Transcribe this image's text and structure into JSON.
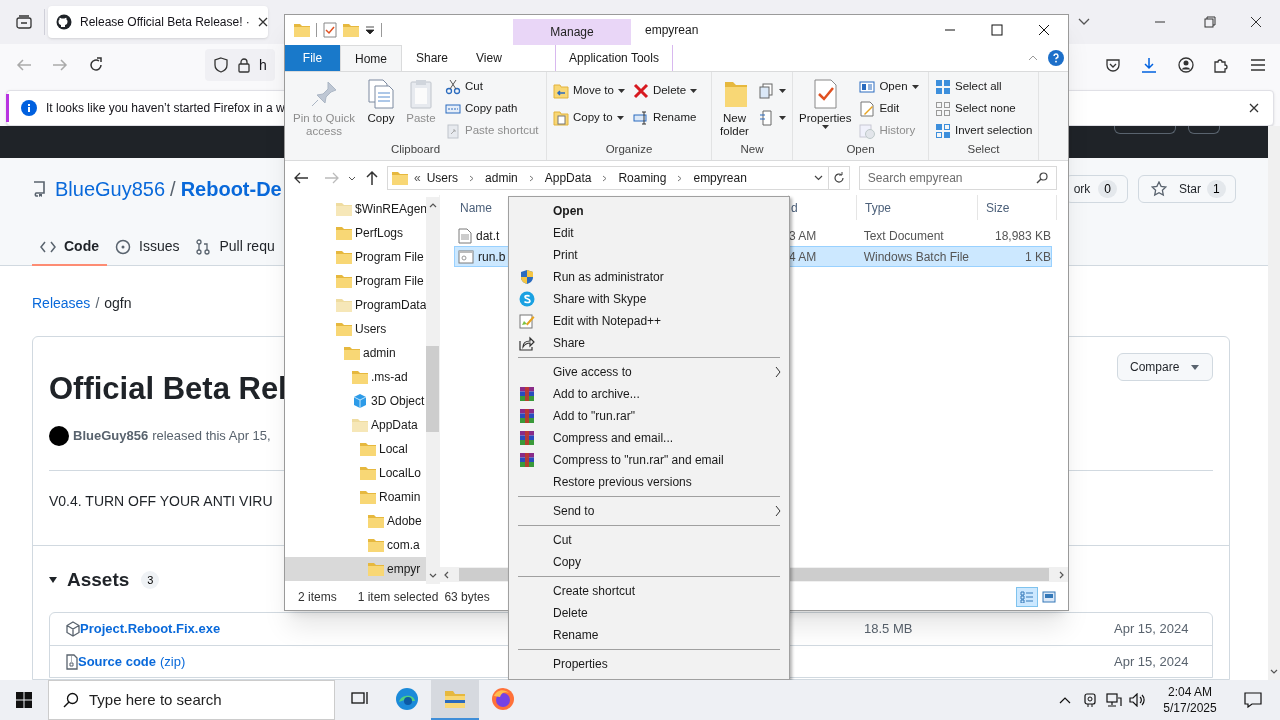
{
  "browser": {
    "tab": {
      "title": "Release Official Beta Release! ·"
    },
    "address": {
      "value": "h"
    },
    "notification": {
      "text": "It looks like you haven’t started Firefox in a w"
    }
  },
  "github": {
    "owner": "BlueGuy856",
    "separator": "/",
    "repo": "Reboot-De",
    "tabs": [
      {
        "label": "Code",
        "selected": true
      },
      {
        "label": "Issues",
        "selected": false
      },
      {
        "label": "Pull requ",
        "selected": false
      }
    ],
    "fork": {
      "label": "ork",
      "count": "0"
    },
    "star": {
      "label": "Star",
      "count": "1"
    },
    "breadcrumb": {
      "link": "Releases",
      "separator": "/",
      "current": "ogfn"
    },
    "release": {
      "title": "Official Beta Rel",
      "author": "BlueGuy856",
      "meta": "released this Apr 15,",
      "body": "V0.4. TURN OFF YOUR ANTI VIRU",
      "compare": "Compare"
    },
    "assets": {
      "label": "Assets",
      "count": "3",
      "items": [
        {
          "kind": "package",
          "name": "Project.Reboot.Fix.exe",
          "size": "18.5 MB",
          "date": "Apr 15, 2024"
        },
        {
          "kind": "zip",
          "name": "Source code",
          "suffix": "(zip)",
          "date": "Apr 15, 2024"
        }
      ]
    }
  },
  "explorer": {
    "title": "empyrean",
    "context_tab": "Manage",
    "tabs": [
      {
        "label": "File",
        "selected": false,
        "kind": "file"
      },
      {
        "label": "Home",
        "selected": true,
        "kind": "normal"
      },
      {
        "label": "Share",
        "selected": false,
        "kind": "normal"
      },
      {
        "label": "View",
        "selected": false,
        "kind": "normal"
      },
      {
        "label": "Application Tools",
        "selected": false,
        "kind": "context"
      }
    ],
    "groups": [
      {
        "label": "Clipboard",
        "large": [
          {
            "label": "Pin to Quick access",
            "kind": "pin",
            "disabled": true,
            "dropdown": false
          },
          {
            "label": "Copy",
            "kind": "copy",
            "disabled": false,
            "dropdown": false
          },
          {
            "label": "Paste",
            "kind": "paste",
            "disabled": true,
            "dropdown": false
          }
        ],
        "small": [
          [
            {
              "label": "Cut",
              "kind": "cut",
              "disabled": false,
              "dropdown": false
            },
            {
              "label": "Copy path",
              "kind": "copy-path",
              "disabled": false,
              "dropdown": false
            },
            {
              "label": "Paste shortcut",
              "kind": "paste-shortcut",
              "disabled": true,
              "dropdown": false
            }
          ]
        ]
      },
      {
        "label": "Organize",
        "small": [
          [
            {
              "label": "Move to",
              "kind": "move",
              "disabled": false,
              "dropdown": true
            },
            {
              "label": "Copy to",
              "kind": "copy-to",
              "disabled": false,
              "dropdown": true
            }
          ],
          [
            {
              "label": "Delete",
              "kind": "delete",
              "disabled": false,
              "dropdown": true
            },
            {
              "label": "Rename",
              "kind": "rename",
              "disabled": false,
              "dropdown": false
            }
          ]
        ]
      },
      {
        "label": "New",
        "large": [
          {
            "label": "New folder",
            "kind": "new-folder",
            "disabled": false,
            "dropdown": false
          }
        ],
        "small": [
          [
            {
              "kind": "new-item",
              "disabled": false,
              "dropdown": true
            },
            {
              "kind": "easy-access",
              "disabled": false,
              "dropdown": true
            }
          ]
        ]
      },
      {
        "label": "Open",
        "large": [
          {
            "label": "Properties",
            "kind": "properties",
            "disabled": false,
            "dropdown": true
          }
        ],
        "small": [
          [
            {
              "label": "Open",
              "kind": "open",
              "disabled": false,
              "dropdown": true
            },
            {
              "label": "Edit",
              "kind": "edit",
              "disabled": false,
              "dropdown": false
            },
            {
              "label": "History",
              "kind": "history",
              "disabled": true,
              "dropdown": false
            }
          ]
        ]
      },
      {
        "label": "Select",
        "small": [
          [
            {
              "label": "Select all",
              "kind": "select-all",
              "disabled": false,
              "dropdown": false
            },
            {
              "label": "Select none",
              "kind": "select-none",
              "disabled": false,
              "dropdown": false
            },
            {
              "label": "Invert selection",
              "kind": "invert",
              "disabled": false,
              "dropdown": false
            }
          ]
        ]
      }
    ],
    "address": {
      "overflow": "«",
      "path": [
        "Users",
        "admin",
        "AppData",
        "Roaming",
        "empyrean"
      ]
    },
    "search": {
      "placeholder": "Search empyrean"
    },
    "tree": [
      {
        "label": "$WinREAgen",
        "kind": "folder",
        "hidden": true,
        "selected": false
      },
      {
        "label": "PerfLogs",
        "kind": "folder",
        "hidden": false,
        "selected": false
      },
      {
        "label": "Program File",
        "kind": "folder",
        "hidden": false,
        "selected": false
      },
      {
        "label": "Program File",
        "kind": "folder",
        "hidden": false,
        "selected": false
      },
      {
        "label": "ProgramData",
        "kind": "folder",
        "hidden": true,
        "selected": false
      },
      {
        "label": "Users",
        "kind": "folder",
        "hidden": false,
        "selected": false,
        "children": [
          {
            "label": "admin",
            "kind": "folder",
            "hidden": false,
            "selected": false,
            "children": [
              {
                "label": ".ms-ad",
                "kind": "folder",
                "hidden": false,
                "selected": false
              },
              {
                "label": "3D Object",
                "kind": "cube",
                "hidden": false,
                "selected": false
              },
              {
                "label": "AppData",
                "kind": "folder",
                "hidden": true,
                "selected": false,
                "children": [
                  {
                    "label": "Local",
                    "kind": "folder",
                    "hidden": false,
                    "selected": false
                  },
                  {
                    "label": "LocalLo",
                    "kind": "folder",
                    "hidden": false,
                    "selected": false
                  },
                  {
                    "label": "Roamin",
                    "kind": "folder",
                    "hidden": false,
                    "selected": false,
                    "children": [
                      {
                        "label": "Adobe",
                        "kind": "folder",
                        "hidden": false,
                        "selected": false
                      },
                      {
                        "label": "com.a",
                        "kind": "folder",
                        "hidden": false,
                        "selected": false
                      },
                      {
                        "label": "empyr",
                        "kind": "folder",
                        "hidden": false,
                        "selected": true
                      }
                    ]
                  }
                ]
              }
            ]
          }
        ]
      }
    ],
    "columns": [
      "Name",
      "d",
      "Type",
      "Size"
    ],
    "files": [
      {
        "kind": "text",
        "name": "dat.t",
        "date": "3 AM",
        "type": "Text Document",
        "size": "18,983 KB",
        "selected": false
      },
      {
        "kind": "batch",
        "name": "run.b",
        "date": "4 AM",
        "type": "Windows Batch File",
        "size": "1 KB",
        "selected": true
      }
    ],
    "status": {
      "count": "2 items",
      "selection": "1 item selected",
      "size": "63 bytes"
    }
  },
  "context_menu": [
    {
      "kind": "plain",
      "label": "Open",
      "default": true,
      "submenu": false
    },
    {
      "kind": "plain",
      "label": "Edit",
      "default": false,
      "submenu": false
    },
    {
      "kind": "plain",
      "label": "Print",
      "default": false,
      "submenu": false
    },
    {
      "kind": "shield",
      "label": "Run as administrator",
      "default": false,
      "submenu": false
    },
    {
      "kind": "skype",
      "label": "Share with Skype",
      "default": false,
      "submenu": false
    },
    {
      "kind": "notepad",
      "label": "Edit with Notepad++",
      "default": false,
      "submenu": false
    },
    {
      "kind": "share",
      "label": "Share",
      "default": false,
      "submenu": false
    },
    {
      "kind": "separator"
    },
    {
      "kind": "plain",
      "label": "Give access to",
      "default": false,
      "submenu": true
    },
    {
      "kind": "archive",
      "label": "Add to archive...",
      "default": false,
      "submenu": false
    },
    {
      "kind": "archive",
      "label": "Add to \"run.rar\"",
      "default": false,
      "submenu": false
    },
    {
      "kind": "archive",
      "label": "Compress and email...",
      "default": false,
      "submenu": false
    },
    {
      "kind": "archive",
      "label": "Compress to \"run.rar\" and email",
      "default": false,
      "submenu": false
    },
    {
      "kind": "plain",
      "label": "Restore previous versions",
      "default": false,
      "submenu": false
    },
    {
      "kind": "separator"
    },
    {
      "kind": "plain",
      "label": "Send to",
      "default": false,
      "submenu": true
    },
    {
      "kind": "separator"
    },
    {
      "kind": "plain",
      "label": "Cut",
      "default": false,
      "submenu": false
    },
    {
      "kind": "plain",
      "label": "Copy",
      "default": false,
      "submenu": false
    },
    {
      "kind": "separator"
    },
    {
      "kind": "plain",
      "label": "Create shortcut",
      "default": false,
      "submenu": false
    },
    {
      "kind": "plain",
      "label": "Delete",
      "default": false,
      "submenu": false
    },
    {
      "kind": "plain",
      "label": "Rename",
      "default": false,
      "submenu": false
    },
    {
      "kind": "separator"
    },
    {
      "kind": "plain",
      "label": "Properties",
      "default": false,
      "submenu": false
    }
  ],
  "taskbar": {
    "search": {
      "placeholder": "Type here to search"
    },
    "apps": [
      {
        "kind": "task-view",
        "active": false
      },
      {
        "kind": "edge",
        "active": false
      },
      {
        "kind": "explorer",
        "active": true
      },
      {
        "kind": "firefox",
        "active": false
      }
    ],
    "time": "2:04 AM",
    "date": "5/17/2025"
  }
}
